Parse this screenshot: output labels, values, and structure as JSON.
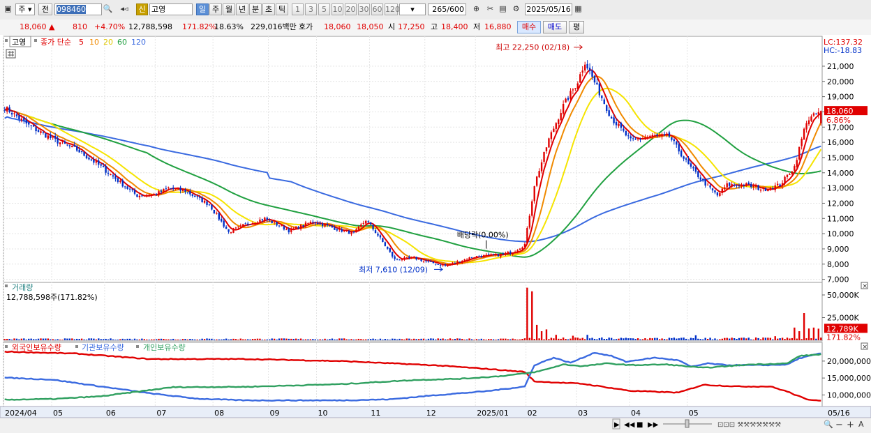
{
  "toolbar": {
    "market_label": "주",
    "type_label": "전",
    "code_value": "098460",
    "badge_label": "신",
    "name_value": "고영",
    "periods": [
      "일",
      "주",
      "월",
      "년",
      "분",
      "초",
      "틱"
    ],
    "minutes": [
      "1",
      "3",
      "5",
      "10",
      "20",
      "30",
      "60",
      "120"
    ],
    "count_value": "265",
    "count_total": "/600",
    "date_value": "2025/05/16"
  },
  "quote": {
    "price": "18,060",
    "change": "810",
    "change_pct": "+4.70%",
    "volume": "12,788,598",
    "volume_ratio": "171.82%",
    "turnover": "18.63%",
    "amount": "229,016백만",
    "hoga_label": "호가",
    "ask": "18,060",
    "bid": "18,050",
    "open_label": "시",
    "open": "17,250",
    "high_label": "고",
    "high": "18,400",
    "low_label": "저",
    "low": "16,880",
    "buy_label": "매수",
    "sell_label": "매도",
    "avg_label": "평"
  },
  "colors": {
    "up": "#e00000",
    "down": "#0030c8",
    "ma5": "#e00000",
    "ma10": "#f08a00",
    "ma20": "#f5e400",
    "ma60": "#20a040",
    "ma120": "#3a6ae0",
    "foreign": "#e00000",
    "inst": "#3a6ae0",
    "indiv": "#30a060"
  },
  "chart_data": [
    {
      "type": "candlestick",
      "title_tag": "고영",
      "legend_title": "종가 단순",
      "legend": [
        "5",
        "10",
        "20",
        "60",
        "120"
      ],
      "lc_label": "LC:137.32",
      "hc_label": "HC:-18.83",
      "ylim": [
        6800,
        22600
      ],
      "yticks": [
        "21,000",
        "20,000",
        "19,000",
        "18,000",
        "17,000",
        "16,000",
        "15,000",
        "14,000",
        "13,000",
        "12,000",
        "11,000",
        "10,000",
        "9,000",
        "8,000",
        "7,000"
      ],
      "ytick_values": [
        21000,
        20000,
        19000,
        18000,
        17000,
        16000,
        15000,
        14000,
        13000,
        12000,
        11000,
        10000,
        9000,
        8000,
        7000
      ],
      "last_price_label": "18,060",
      "last_pct_label": "6.86%",
      "last_value": 18060,
      "high_annotation": "최고 22,250 (02/18)",
      "high_value": 22250,
      "low_annotation": "최저 7,610 (12/09)",
      "low_value": 7610,
      "dividend_annotation": "배당락(0.00%)",
      "close_anchors": [
        [
          0,
          18300
        ],
        [
          10,
          17100
        ],
        [
          20,
          16200
        ],
        [
          30,
          15500
        ],
        [
          40,
          14400
        ],
        [
          50,
          13100
        ],
        [
          55,
          12500
        ],
        [
          63,
          12600
        ],
        [
          68,
          13000
        ],
        [
          75,
          12800
        ],
        [
          85,
          11900
        ],
        [
          93,
          10100
        ],
        [
          100,
          10600
        ],
        [
          108,
          11000
        ],
        [
          118,
          10200
        ],
        [
          128,
          10800
        ],
        [
          138,
          10300
        ],
        [
          145,
          10000
        ],
        [
          150,
          10900
        ],
        [
          155,
          9900
        ],
        [
          162,
          8300
        ],
        [
          170,
          8400
        ],
        [
          177,
          8100
        ],
        [
          183,
          7900
        ],
        [
          195,
          8500
        ],
        [
          205,
          8600
        ],
        [
          211,
          8800
        ],
        [
          216,
          9300
        ],
        [
          220,
          13200
        ],
        [
          226,
          16200
        ],
        [
          232,
          18400
        ],
        [
          238,
          20000
        ],
        [
          241,
          21300
        ],
        [
          246,
          19600
        ],
        [
          252,
          17600
        ],
        [
          260,
          16100
        ],
        [
          268,
          16400
        ],
        [
          276,
          16400
        ],
        [
          284,
          14500
        ],
        [
          292,
          13100
        ],
        [
          296,
          12500
        ],
        [
          300,
          13200
        ],
        [
          308,
          13200
        ],
        [
          315,
          12900
        ],
        [
          322,
          13200
        ],
        [
          328,
          14400
        ],
        [
          333,
          17400
        ],
        [
          339,
          18060
        ]
      ],
      "volume_panel": {
        "title": "거래량",
        "readout": "12,788,598주(171.82%)",
        "yticks": [
          "50,000K",
          "25,000K"
        ],
        "ytick_values": [
          50000,
          25000
        ],
        "ymax": 60000,
        "last_label": "12,789K",
        "last_pct": "171.82%",
        "last_value": 12789,
        "spikes": [
          [
            217,
            58000
          ],
          [
            219,
            54000
          ],
          [
            221,
            17000
          ],
          [
            223,
            10000
          ],
          [
            225,
            12000
          ],
          [
            229,
            6000
          ],
          [
            236,
            5000
          ],
          [
            242,
            6000
          ],
          [
            287,
            5500
          ],
          [
            320,
            4500
          ],
          [
            328,
            14000
          ],
          [
            330,
            10000
          ],
          [
            332,
            30000
          ],
          [
            334,
            13000
          ],
          [
            336,
            14000
          ],
          [
            338,
            12789
          ]
        ]
      },
      "holdings_panel": {
        "legend": [
          "외국인보유수량",
          "기관보유수량",
          "개인보유수량"
        ],
        "yticks": [
          "20,000,000",
          "15,000,000",
          "10,000,000"
        ],
        "ytick_values": [
          20000000,
          15000000,
          10000000
        ],
        "ylim": [
          7000000,
          24500000
        ],
        "foreign": [
          [
            0,
            22800000
          ],
          [
            30,
            22200000
          ],
          [
            60,
            20600000
          ],
          [
            100,
            20600000
          ],
          [
            140,
            20000000
          ],
          [
            180,
            18700000
          ],
          [
            200,
            17700000
          ],
          [
            216,
            16800000
          ],
          [
            220,
            14000000
          ],
          [
            240,
            13300000
          ],
          [
            260,
            11200000
          ],
          [
            280,
            10700000
          ],
          [
            290,
            13000000
          ],
          [
            305,
            12500000
          ],
          [
            318,
            12500000
          ],
          [
            325,
            11000000
          ],
          [
            333,
            8700000
          ],
          [
            339,
            8400000
          ]
        ],
        "inst": [
          [
            0,
            15100000
          ],
          [
            20,
            14500000
          ],
          [
            40,
            12500000
          ],
          [
            60,
            10500000
          ],
          [
            80,
            8900000
          ],
          [
            100,
            8400000
          ],
          [
            140,
            8400000
          ],
          [
            160,
            8700000
          ],
          [
            180,
            10000000
          ],
          [
            200,
            11100000
          ],
          [
            216,
            12500000
          ],
          [
            220,
            18800000
          ],
          [
            228,
            21000000
          ],
          [
            235,
            19500000
          ],
          [
            245,
            22500000
          ],
          [
            252,
            21500000
          ],
          [
            258,
            19800000
          ],
          [
            270,
            21000000
          ],
          [
            280,
            20200000
          ],
          [
            285,
            18300000
          ],
          [
            292,
            19300000
          ],
          [
            300,
            18800000
          ],
          [
            315,
            18800000
          ],
          [
            325,
            19000000
          ],
          [
            330,
            20800000
          ],
          [
            339,
            22300000
          ]
        ],
        "indiv": [
          [
            0,
            8600000
          ],
          [
            20,
            8800000
          ],
          [
            40,
            9600000
          ],
          [
            70,
            12300000
          ],
          [
            100,
            12400000
          ],
          [
            140,
            13200000
          ],
          [
            170,
            14400000
          ],
          [
            190,
            14800000
          ],
          [
            205,
            15500000
          ],
          [
            218,
            16500000
          ],
          [
            222,
            17000000
          ],
          [
            232,
            19000000
          ],
          [
            240,
            18500000
          ],
          [
            250,
            19300000
          ],
          [
            260,
            18800000
          ],
          [
            275,
            19000000
          ],
          [
            290,
            18000000
          ],
          [
            310,
            19000000
          ],
          [
            325,
            19300000
          ],
          [
            330,
            21500000
          ],
          [
            339,
            22000000
          ]
        ]
      },
      "xticks": [
        {
          "label": "2024/04",
          "i": 0
        },
        {
          "label": "05",
          "i": 20
        },
        {
          "label": "06",
          "i": 42
        },
        {
          "label": "07",
          "i": 63
        },
        {
          "label": "08",
          "i": 87
        },
        {
          "label": "09",
          "i": 110
        },
        {
          "label": "10",
          "i": 130
        },
        {
          "label": "11",
          "i": 152
        },
        {
          "label": "12",
          "i": 175
        },
        {
          "label": "2025/01",
          "i": 196
        },
        {
          "label": "02",
          "i": 217
        },
        {
          "label": "03",
          "i": 238
        },
        {
          "label": "04",
          "i": 260
        },
        {
          "label": "05",
          "i": 284
        },
        {
          "label": "05/16",
          "i": 305
        }
      ],
      "n_bars": 340
    }
  ]
}
